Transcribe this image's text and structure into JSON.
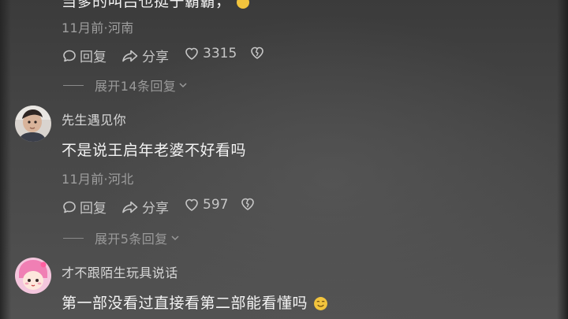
{
  "comments": [
    {
      "text": "当爹的叫吕也挺于霸霸，",
      "meta": "11月前·河南",
      "reply_label": "回复",
      "share_label": "分享",
      "likes": "3315",
      "expand_label": "展开14条回复"
    },
    {
      "username": "先生遇见你",
      "text": "不是说王启年老婆不好看吗",
      "meta": "11月前·河北",
      "reply_label": "回复",
      "share_label": "分享",
      "likes": "597",
      "expand_label": "展开5条回复"
    },
    {
      "username": "才不跟陌生玩具说话",
      "text": "第一部没看过直接看第二部能看懂吗"
    }
  ],
  "icons": {
    "reply": "reply-bubble-icon",
    "share": "share-arrow-icon",
    "like": "heart-icon",
    "dislike": "broken-heart-icon",
    "expand": "chevron-down-icon",
    "emoji": "emoji-icon"
  },
  "colors": {
    "background": "#444444",
    "text_primary": "#f3f3f3",
    "text_secondary": "#9f9f9f",
    "emoji": "#f2c43d"
  }
}
